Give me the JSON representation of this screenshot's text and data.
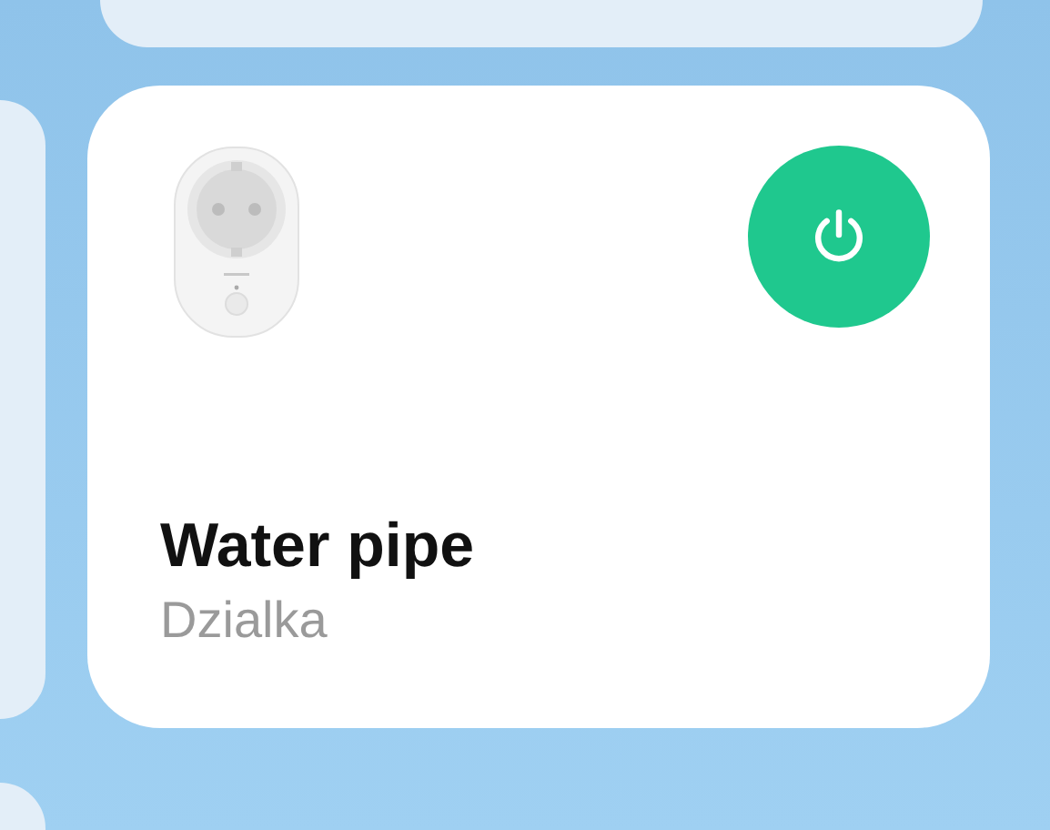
{
  "device_card": {
    "name": "Water pipe",
    "room": "Dzialka",
    "power": {
      "on": true
    }
  }
}
